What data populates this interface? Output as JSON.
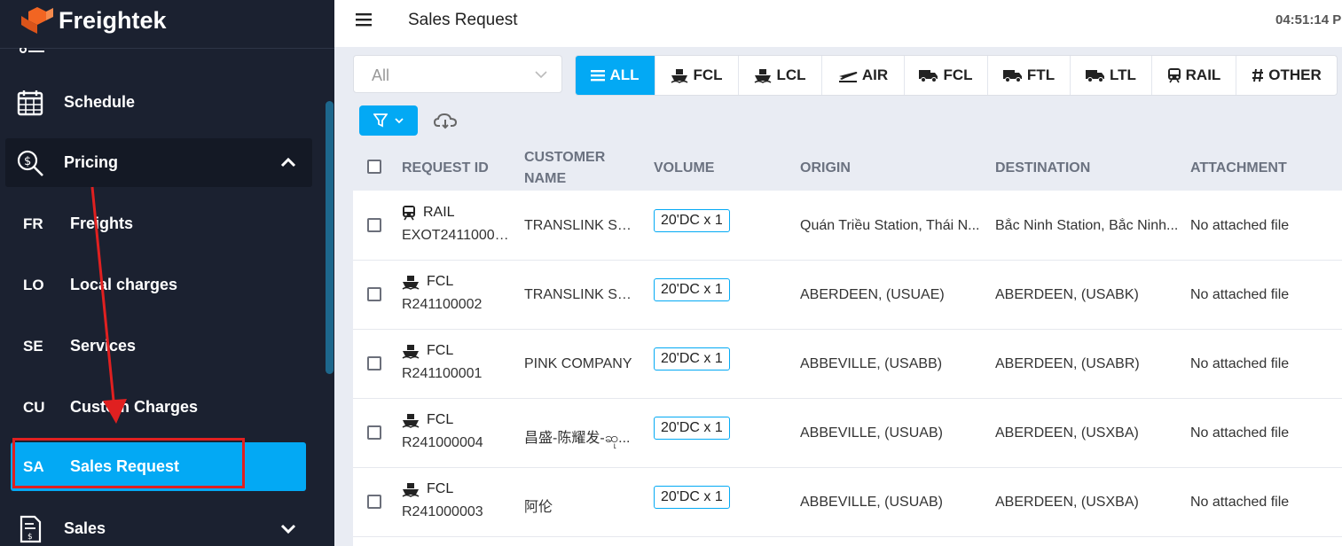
{
  "brand": {
    "name": "Freightek",
    "accent": "#f26522"
  },
  "sidebar": {
    "items": [
      {
        "label": "Schedule",
        "icon": "calendar-icon"
      },
      {
        "label": "Pricing",
        "icon": "pricing-search-icon",
        "expanded": true
      },
      {
        "label": "Sales",
        "icon": "invoice-icon",
        "expanded": false
      }
    ],
    "pricing_sub": [
      {
        "abbr": "FR",
        "label": "Freights"
      },
      {
        "abbr": "LO",
        "label": "Local charges"
      },
      {
        "abbr": "SE",
        "label": "Services"
      },
      {
        "abbr": "CU",
        "label": "Custom Charges"
      },
      {
        "abbr": "SA",
        "label": "Sales Request",
        "active": true
      }
    ]
  },
  "header": {
    "title": "Sales Request",
    "time": "04:51:14 P"
  },
  "filters": {
    "select_value": "All",
    "tabs": [
      {
        "label": "ALL",
        "icon": "list-icon",
        "active": true
      },
      {
        "label": "FCL",
        "icon": "ship-icon"
      },
      {
        "label": "LCL",
        "icon": "ship-icon"
      },
      {
        "label": "AIR",
        "icon": "plane-icon"
      },
      {
        "label": "FCL",
        "icon": "truck-icon"
      },
      {
        "label": "FTL",
        "icon": "truck-icon"
      },
      {
        "label": "LTL",
        "icon": "truck-icon"
      },
      {
        "label": "RAIL",
        "icon": "train-icon"
      },
      {
        "label": "OTHER",
        "icon": "hash-icon"
      }
    ]
  },
  "table": {
    "columns": {
      "request_id": "REQUEST ID",
      "customer": "CUSTOMER NAME",
      "volume": "VOLUME",
      "origin": "ORIGIN",
      "destination": "DESTINATION",
      "attachment": "ATTACHMENT"
    },
    "rows": [
      {
        "type": "RAIL",
        "id": "EXOT24110000...",
        "customer": "TRANSLINK SHI...",
        "volume": "20'DC x 1",
        "origin": "Quán Triều Station, Thái N...",
        "destination": "Bắc Ninh Station, Bắc Ninh...",
        "attachment": "No attached file"
      },
      {
        "type": "FCL",
        "id": "R241100002",
        "customer": "TRANSLINK SHI...",
        "volume": "20'DC x 1",
        "origin": "ABERDEEN, (USUAE)",
        "destination": "ABERDEEN, (USABK)",
        "attachment": "No attached file"
      },
      {
        "type": "FCL",
        "id": "R241100001",
        "customer": "PINK COMPANY",
        "volume": "20'DC x 1",
        "origin": "ABBEVILLE, (USABB)",
        "destination": "ABERDEEN, (USABR)",
        "attachment": "No attached file"
      },
      {
        "type": "FCL",
        "id": "R241000004",
        "customer": "昌盛-陈耀发-ဆု...",
        "volume": "20'DC x 1",
        "origin": "ABBEVILLE, (USUAB)",
        "destination": "ABERDEEN, (USXBA)",
        "attachment": "No attached file"
      },
      {
        "type": "FCL",
        "id": "R241000003",
        "customer": "阿伦",
        "volume": "20'DC x 1",
        "origin": "ABBEVILLE, (USUAB)",
        "destination": "ABERDEEN, (USXBA)",
        "attachment": "No attached file"
      }
    ]
  }
}
